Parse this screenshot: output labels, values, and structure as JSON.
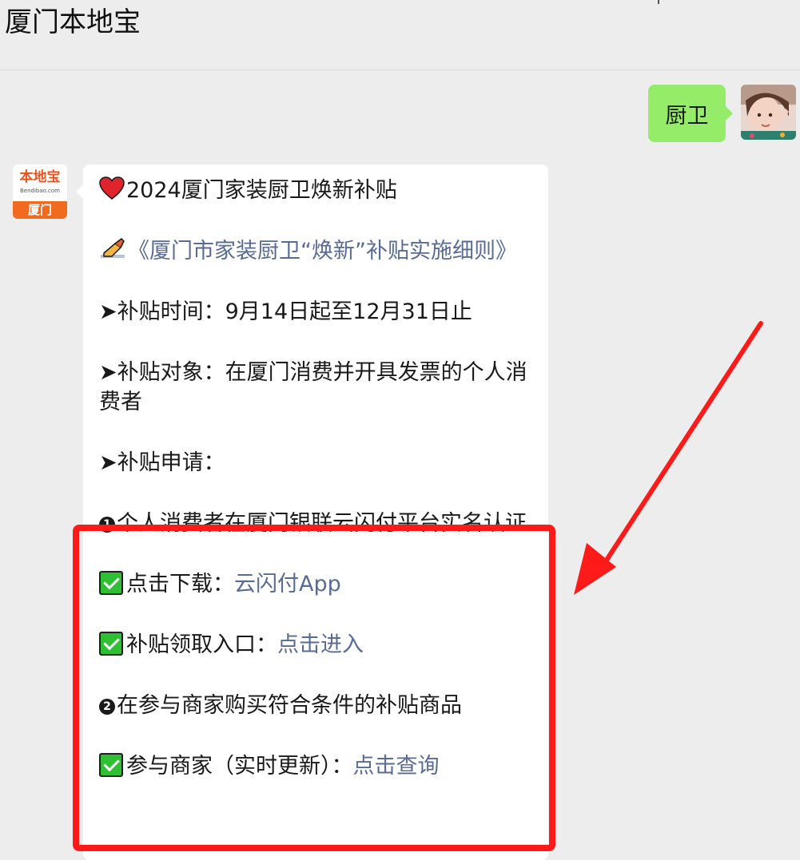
{
  "header": {
    "title": "厦门本地宝"
  },
  "user_message": {
    "text": "厨卫"
  },
  "bot": {
    "avatar": {
      "logo_cn": "本地宝",
      "logo_en": "Bendibao.com",
      "city": "厦门"
    },
    "message": {
      "title": "2024厦门家装厨卫焕新补贴",
      "detail_link": "《厦门市家装厨卫“焕新”补贴实施细则》",
      "time": "➤补贴时间：9月14日起至12月31日止",
      "target": "➤补贴对象：在厦门消费并开具发票的个人消费者",
      "apply_label": "➤补贴申请：",
      "step1": "个人消费者在厦门银联云闪付平台实名认证",
      "download_label": "点击下载：",
      "download_link": "云闪付App",
      "entry_label": "补贴领取入口：",
      "entry_link": "点击进入",
      "step2": "在参与商家购买符合条件的补贴商品",
      "merchant_label": "参与商家（实时更新）：",
      "merchant_link": "点击查询"
    }
  },
  "colors": {
    "chat_bg": "#ededed",
    "user_bubble": "#95ec69",
    "link": "#576b95",
    "highlight": "#ff1a1a"
  },
  "icons": [
    "heart-icon",
    "writing-hand-icon",
    "check-mark-icon",
    "circled-one-icon",
    "circled-two-icon"
  ]
}
